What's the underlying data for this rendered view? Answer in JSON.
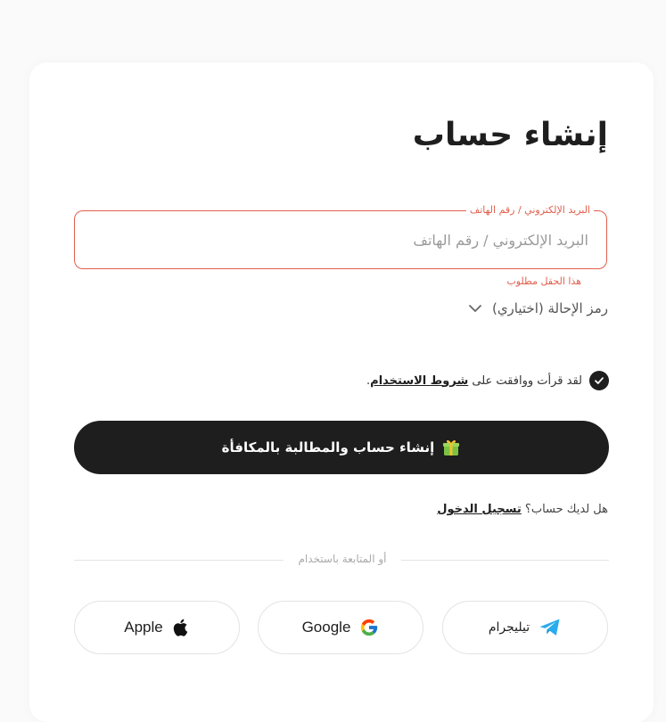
{
  "page": {
    "title": "إنشاء حساب"
  },
  "form": {
    "identifier_label": "البريد الإلكتروني / رقم الهاتف",
    "identifier_placeholder": "البريد الإلكتروني / رقم الهاتف",
    "identifier_value": "",
    "error_text": "هذا الحقل مطلوب",
    "referral_label": "رمز الإحالة (اختياري)",
    "terms_prefix": "لقد قرأت ووافقت على ",
    "terms_link": "شروط الاستخدام",
    "terms_suffix": ".",
    "submit_label": "إنشاء حساب والمطالبة بالمكافأة"
  },
  "login": {
    "prompt": "هل لديك حساب؟ ",
    "link": "تسجيل الدخول"
  },
  "social": {
    "divider_text": "أو المتابعة باستخدام",
    "telegram_label": "تيليجرام",
    "google_label": "Google",
    "apple_label": "Apple"
  },
  "colors": {
    "primary": "#1e1e1e",
    "error": "#e0604e",
    "telegram": "#2aabee"
  },
  "icons": {
    "check": "check-icon",
    "chevron": "chevron-down-icon",
    "gift": "gift-icon",
    "telegram": "telegram-icon",
    "google": "google-icon",
    "apple": "apple-icon"
  }
}
